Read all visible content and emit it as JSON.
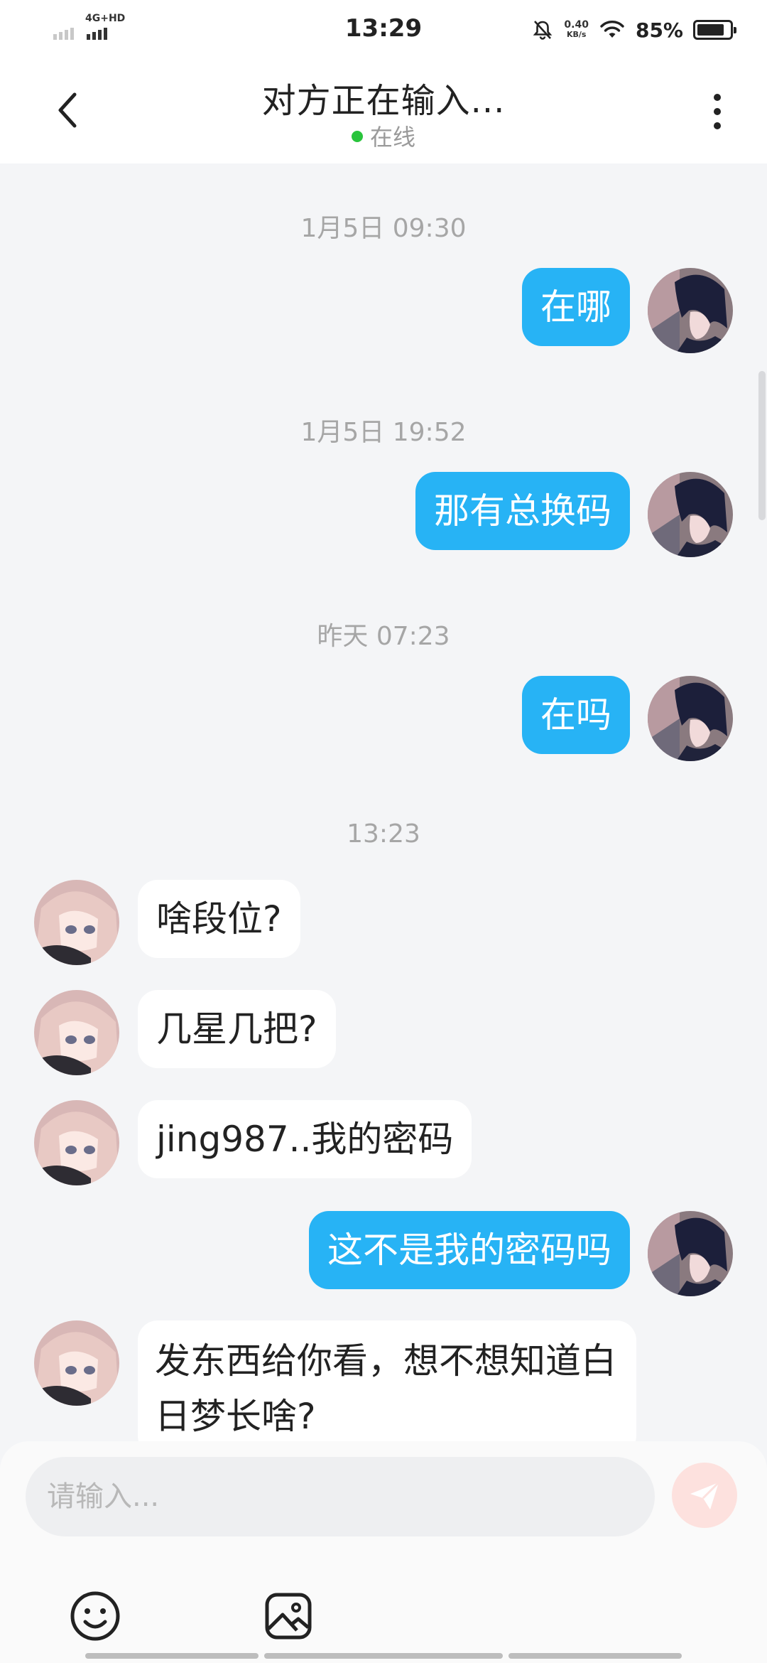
{
  "status_bar": {
    "network_label": "4G+HD",
    "time": "13:29",
    "speed_value": "0.40",
    "speed_unit": "KB/s",
    "battery_percent": "85%",
    "battery_level": 0.85
  },
  "header": {
    "title": "对方正在输入...",
    "status": "在线",
    "online_color": "#29c43c"
  },
  "colors": {
    "outgoing_bubble": "#27b3f5",
    "incoming_bubble": "#ffffff",
    "background": "#f4f5f7"
  },
  "messages": [
    {
      "timestamp": "1月5日 09:30"
    },
    {
      "sender": "me",
      "text": "在哪"
    },
    {
      "timestamp": "1月5日 19:52"
    },
    {
      "sender": "me",
      "text": "那有总换码"
    },
    {
      "timestamp": "昨天 07:23"
    },
    {
      "sender": "me",
      "text": "在吗"
    },
    {
      "timestamp": "13:23"
    },
    {
      "sender": "other",
      "text": "啥段位?"
    },
    {
      "sender": "other",
      "text": "几星几把?"
    },
    {
      "sender": "other",
      "text": "jing987..我的密码"
    },
    {
      "sender": "me",
      "text": "这不是我的密码吗"
    },
    {
      "sender": "other",
      "text": "发东西给你看，想不想知道白日梦长啥?"
    }
  ],
  "input": {
    "placeholder": "请输入..."
  },
  "toolbar": {
    "emoji_icon": "emoji-icon",
    "image_icon": "image-icon",
    "send_icon": "send-icon"
  }
}
